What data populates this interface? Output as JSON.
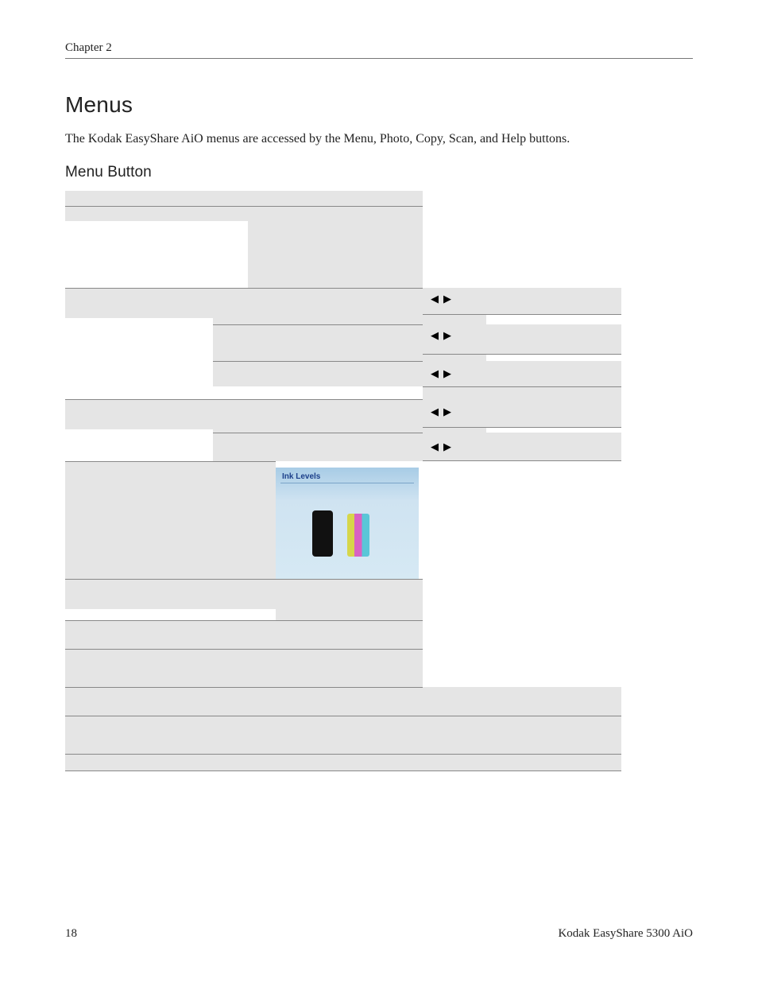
{
  "header": {
    "chapter": "Chapter 2"
  },
  "section": {
    "title": "Menus",
    "intro": "The Kodak EasyShare AiO menus are accessed by the Menu, Photo, Copy, Scan, and Help buttons.",
    "subtitle": "Menu Button"
  },
  "photo": {
    "label": "Ink Levels"
  },
  "arrows": {
    "left": "◀",
    "right": "▶"
  },
  "footer": {
    "page": "18",
    "product": "Kodak EasyShare 5300 AiO"
  }
}
